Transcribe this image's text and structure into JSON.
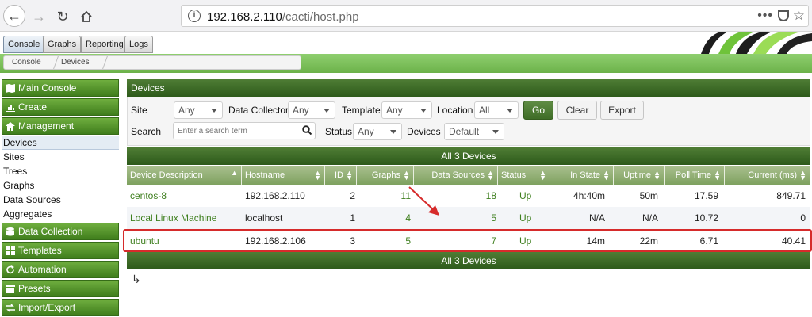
{
  "browser": {
    "url_host": "192.168.2.110",
    "url_path": "/cacti/host.php",
    "menu_dots": "•••"
  },
  "tabs": [
    "Console",
    "Graphs",
    "Reporting",
    "Logs"
  ],
  "breadcrumb": [
    "Console",
    "Devices"
  ],
  "sidebar": {
    "headers": [
      "Main Console",
      "Create",
      "Management",
      "Data Collection",
      "Templates",
      "Automation",
      "Presets",
      "Import/Export"
    ],
    "items": [
      "Devices",
      "Sites",
      "Trees",
      "Graphs",
      "Data Sources",
      "Aggregates"
    ]
  },
  "panel": {
    "title": "Devices"
  },
  "filters": {
    "site_label": "Site",
    "site_value": "Any",
    "collector_label": "Data Collector",
    "collector_value": "Any",
    "template_label": "Template",
    "template_value": "Any",
    "location_label": "Location",
    "location_value": "All",
    "go": "Go",
    "clear": "Clear",
    "export": "Export",
    "search_label": "Search",
    "search_placeholder": "Enter a search term",
    "status_label": "Status",
    "status_value": "Any",
    "devices_label": "Devices",
    "devices_value": "Default"
  },
  "count_label": "All 3 Devices",
  "table": {
    "columns": [
      "Device Description",
      "Hostname",
      "ID",
      "Graphs",
      "Data Sources",
      "Status",
      "In State",
      "Uptime",
      "Poll Time",
      "Current (ms)"
    ],
    "rows": [
      {
        "desc": "centos-8",
        "host": "192.168.2.110",
        "id": "2",
        "graphs": "11",
        "ds": "18",
        "status": "Up",
        "instate": "4h:40m",
        "uptime": "50m",
        "poll": "17.59",
        "current": "849.71"
      },
      {
        "desc": "Local Linux Machine",
        "host": "localhost",
        "id": "1",
        "graphs": "4",
        "ds": "5",
        "status": "Up",
        "instate": "N/A",
        "uptime": "N/A",
        "poll": "10.72",
        "current": "0"
      },
      {
        "desc": "ubuntu",
        "host": "192.168.2.106",
        "id": "3",
        "graphs": "5",
        "ds": "7",
        "status": "Up",
        "instate": "14m",
        "uptime": "22m",
        "poll": "6.71",
        "current": "40.41"
      }
    ]
  },
  "colors": {
    "accent_green": "#3f7d1c",
    "link_green": "#3e7f1e",
    "highlight_red": "#d62b2b"
  }
}
